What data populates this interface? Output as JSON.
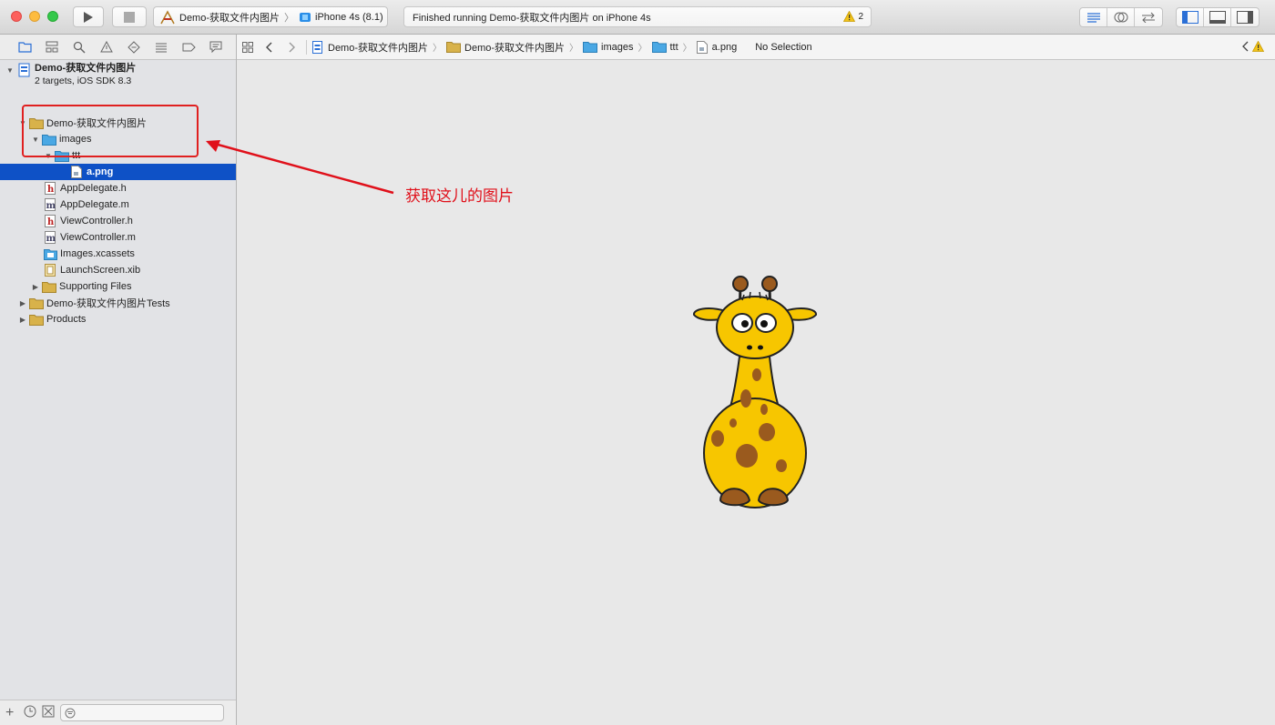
{
  "toolbar": {
    "scheme_name": "Demo-获取文件内图片",
    "device": "iPhone 4s (8.1)",
    "activity_text": "Finished running Demo-获取文件内图片 on iPhone 4s",
    "warning_count": "2"
  },
  "navigator": {
    "project": {
      "name": "Demo-获取文件内图片",
      "subtitle": "2 targets, iOS SDK 8.3"
    },
    "items": [
      {
        "label": "Demo-获取文件内图片"
      },
      {
        "label": "images"
      },
      {
        "label": "ttt"
      },
      {
        "label": "a.png"
      },
      {
        "label": "AppDelegate.h"
      },
      {
        "label": "AppDelegate.m"
      },
      {
        "label": "ViewController.h"
      },
      {
        "label": "ViewController.m"
      },
      {
        "label": "Images.xcassets"
      },
      {
        "label": "LaunchScreen.xib"
      },
      {
        "label": "Supporting Files"
      },
      {
        "label": "Demo-获取文件内图片Tests"
      },
      {
        "label": "Products"
      }
    ]
  },
  "jumpbar": {
    "crumbs": [
      "Demo-获取文件内图片",
      "Demo-获取文件内图片",
      "images",
      "ttt",
      "a.png",
      "No Selection"
    ]
  },
  "annotation": {
    "text": "获取这儿的图片",
    "color": "#e0101a"
  },
  "colors": {
    "selection": "#0e51c6",
    "folder_blue": "#4aa8e4",
    "folder_yellow": "#d8b24a",
    "giraffe_body": "#f7c600",
    "giraffe_spots": "#9a5a1e"
  }
}
